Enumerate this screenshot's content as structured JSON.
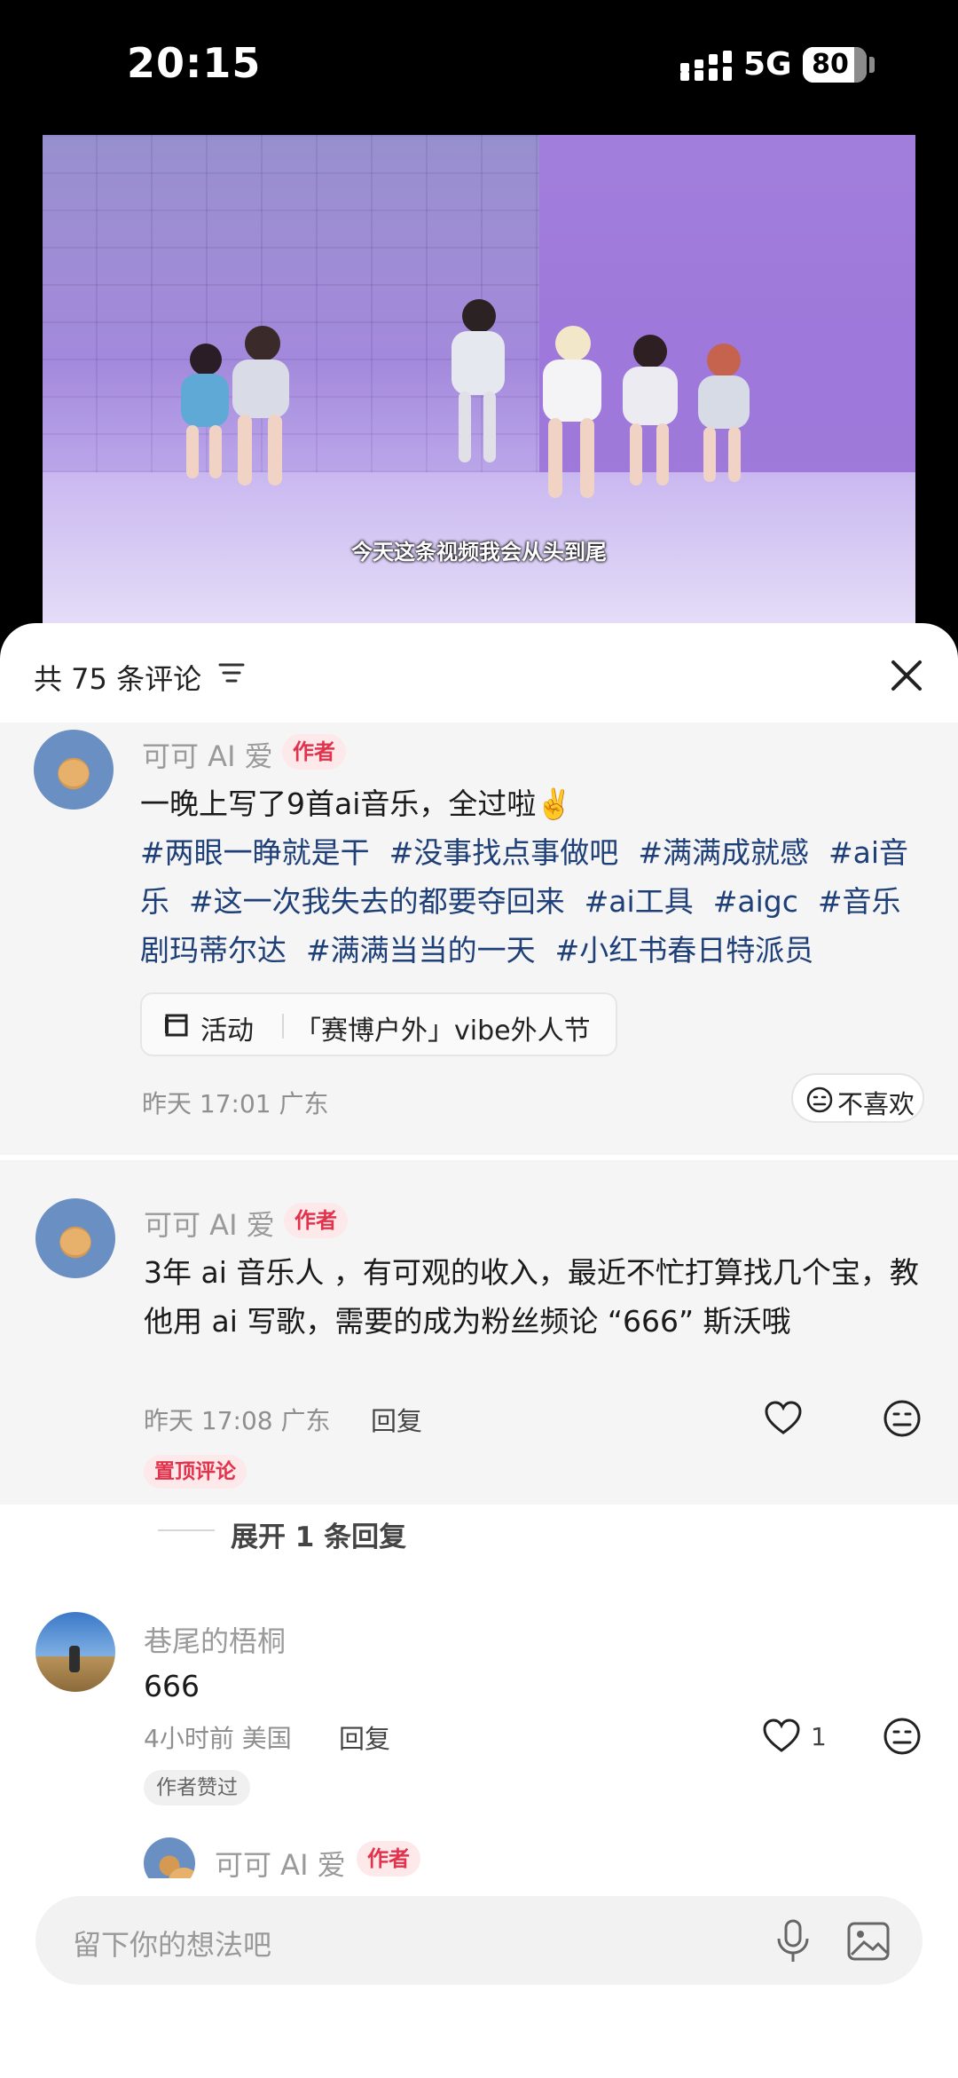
{
  "status_bar": {
    "time": "20:15",
    "network": "5G",
    "battery": "80",
    "battery_level": 0.8
  },
  "video": {
    "subtitle": "今天这条视频我会从头到尾"
  },
  "sheet": {
    "title": "共 75 条评论"
  },
  "comments": [
    {
      "username": "可可 AI 爱",
      "badge": "作者",
      "text": "一晚上写了9首ai音乐，全过啦✌️",
      "hashtags": [
        "#两眼一睁就是干",
        "#没事找点事做吧",
        "#满满成就感",
        "#ai音乐",
        "#这一次我失去的都要夺回来",
        "#ai工具",
        "#aigc",
        "#音乐剧玛蒂尔达",
        "#满满当当的一天",
        "#小红书春日特派员"
      ],
      "activity_label": "活动",
      "activity_title": "「赛博户外」vibe外人节",
      "meta": "昨天 17:01 广东",
      "dislike_label": "不喜欢"
    },
    {
      "username": "可可 AI 爱",
      "badge": "作者",
      "text": "3年          ai 音乐人                    ，有可观的收入，最近不忙打算找几个宝，教他用 ai 写歌，需要的成为粉丝频论 “666” 斯沃哦",
      "meta": "昨天 17:08 广东",
      "reply": "回复",
      "pin_label": "置顶评论",
      "expand": "展开 1 条回复"
    },
    {
      "username": "巷尾的梧桐",
      "text": "666",
      "meta": "4小时前 美国",
      "reply": "回复",
      "likes": "1",
      "liked_badge": "作者赞过"
    },
    {
      "username": "可可 AI 爱",
      "badge": "作者"
    }
  ],
  "input": {
    "placeholder": "留下你的想法吧"
  },
  "colors": {
    "accent_red": "#e2334d",
    "hashtag_blue": "#1e3f78"
  }
}
